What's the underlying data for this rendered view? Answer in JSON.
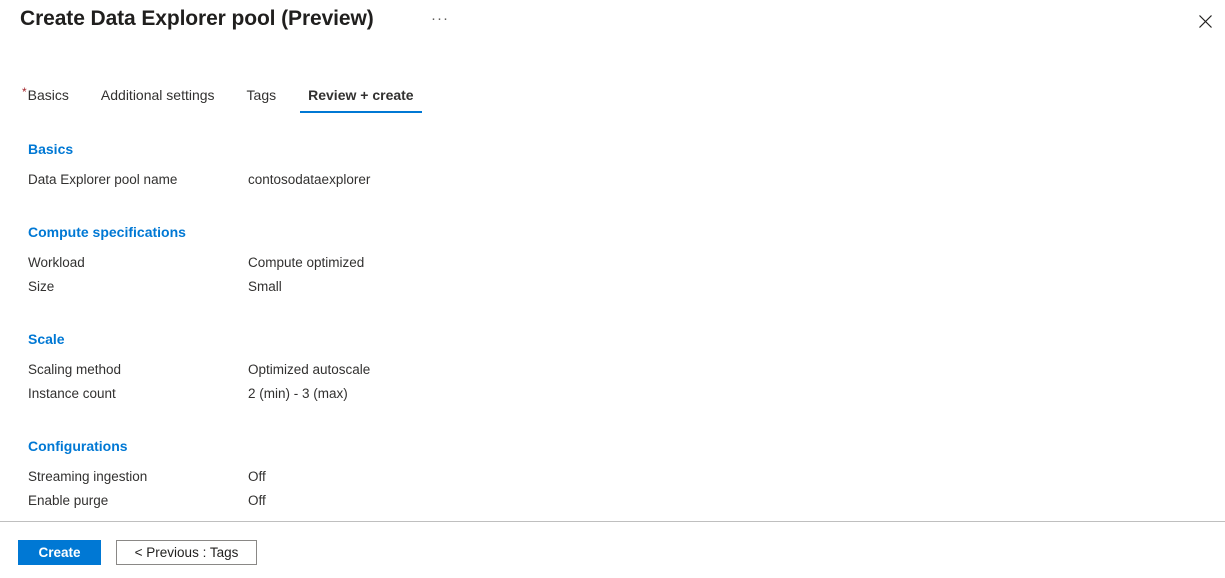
{
  "header": {
    "title": "Create Data Explorer pool (Preview)",
    "ellipsis_label": "···",
    "close_label": ""
  },
  "tabs": [
    {
      "label": "Basics",
      "required": true,
      "active": false
    },
    {
      "label": "Additional settings",
      "required": false,
      "active": false
    },
    {
      "label": "Tags",
      "required": false,
      "active": false
    },
    {
      "label": "Review + create",
      "required": false,
      "active": true
    }
  ],
  "sections": [
    {
      "title": "Basics",
      "rows": [
        {
          "label": "Data Explorer pool name",
          "value": "contosodataexplorer"
        }
      ]
    },
    {
      "title": "Compute specifications",
      "rows": [
        {
          "label": "Workload",
          "value": "Compute optimized"
        },
        {
          "label": "Size",
          "value": "Small"
        }
      ]
    },
    {
      "title": "Scale",
      "rows": [
        {
          "label": "Scaling method",
          "value": "Optimized autoscale"
        },
        {
          "label": "Instance count",
          "value": "2 (min) - 3 (max)"
        }
      ]
    },
    {
      "title": "Configurations",
      "rows": [
        {
          "label": "Streaming ingestion",
          "value": "Off"
        },
        {
          "label": "Enable purge",
          "value": "Off"
        }
      ]
    }
  ],
  "footer": {
    "create_label": "Create",
    "previous_label": "< Previous : Tags"
  },
  "colors": {
    "accent": "#0078d4",
    "required_star": "#a4262c",
    "text": "#323130",
    "divider": "#bfbfbf"
  }
}
